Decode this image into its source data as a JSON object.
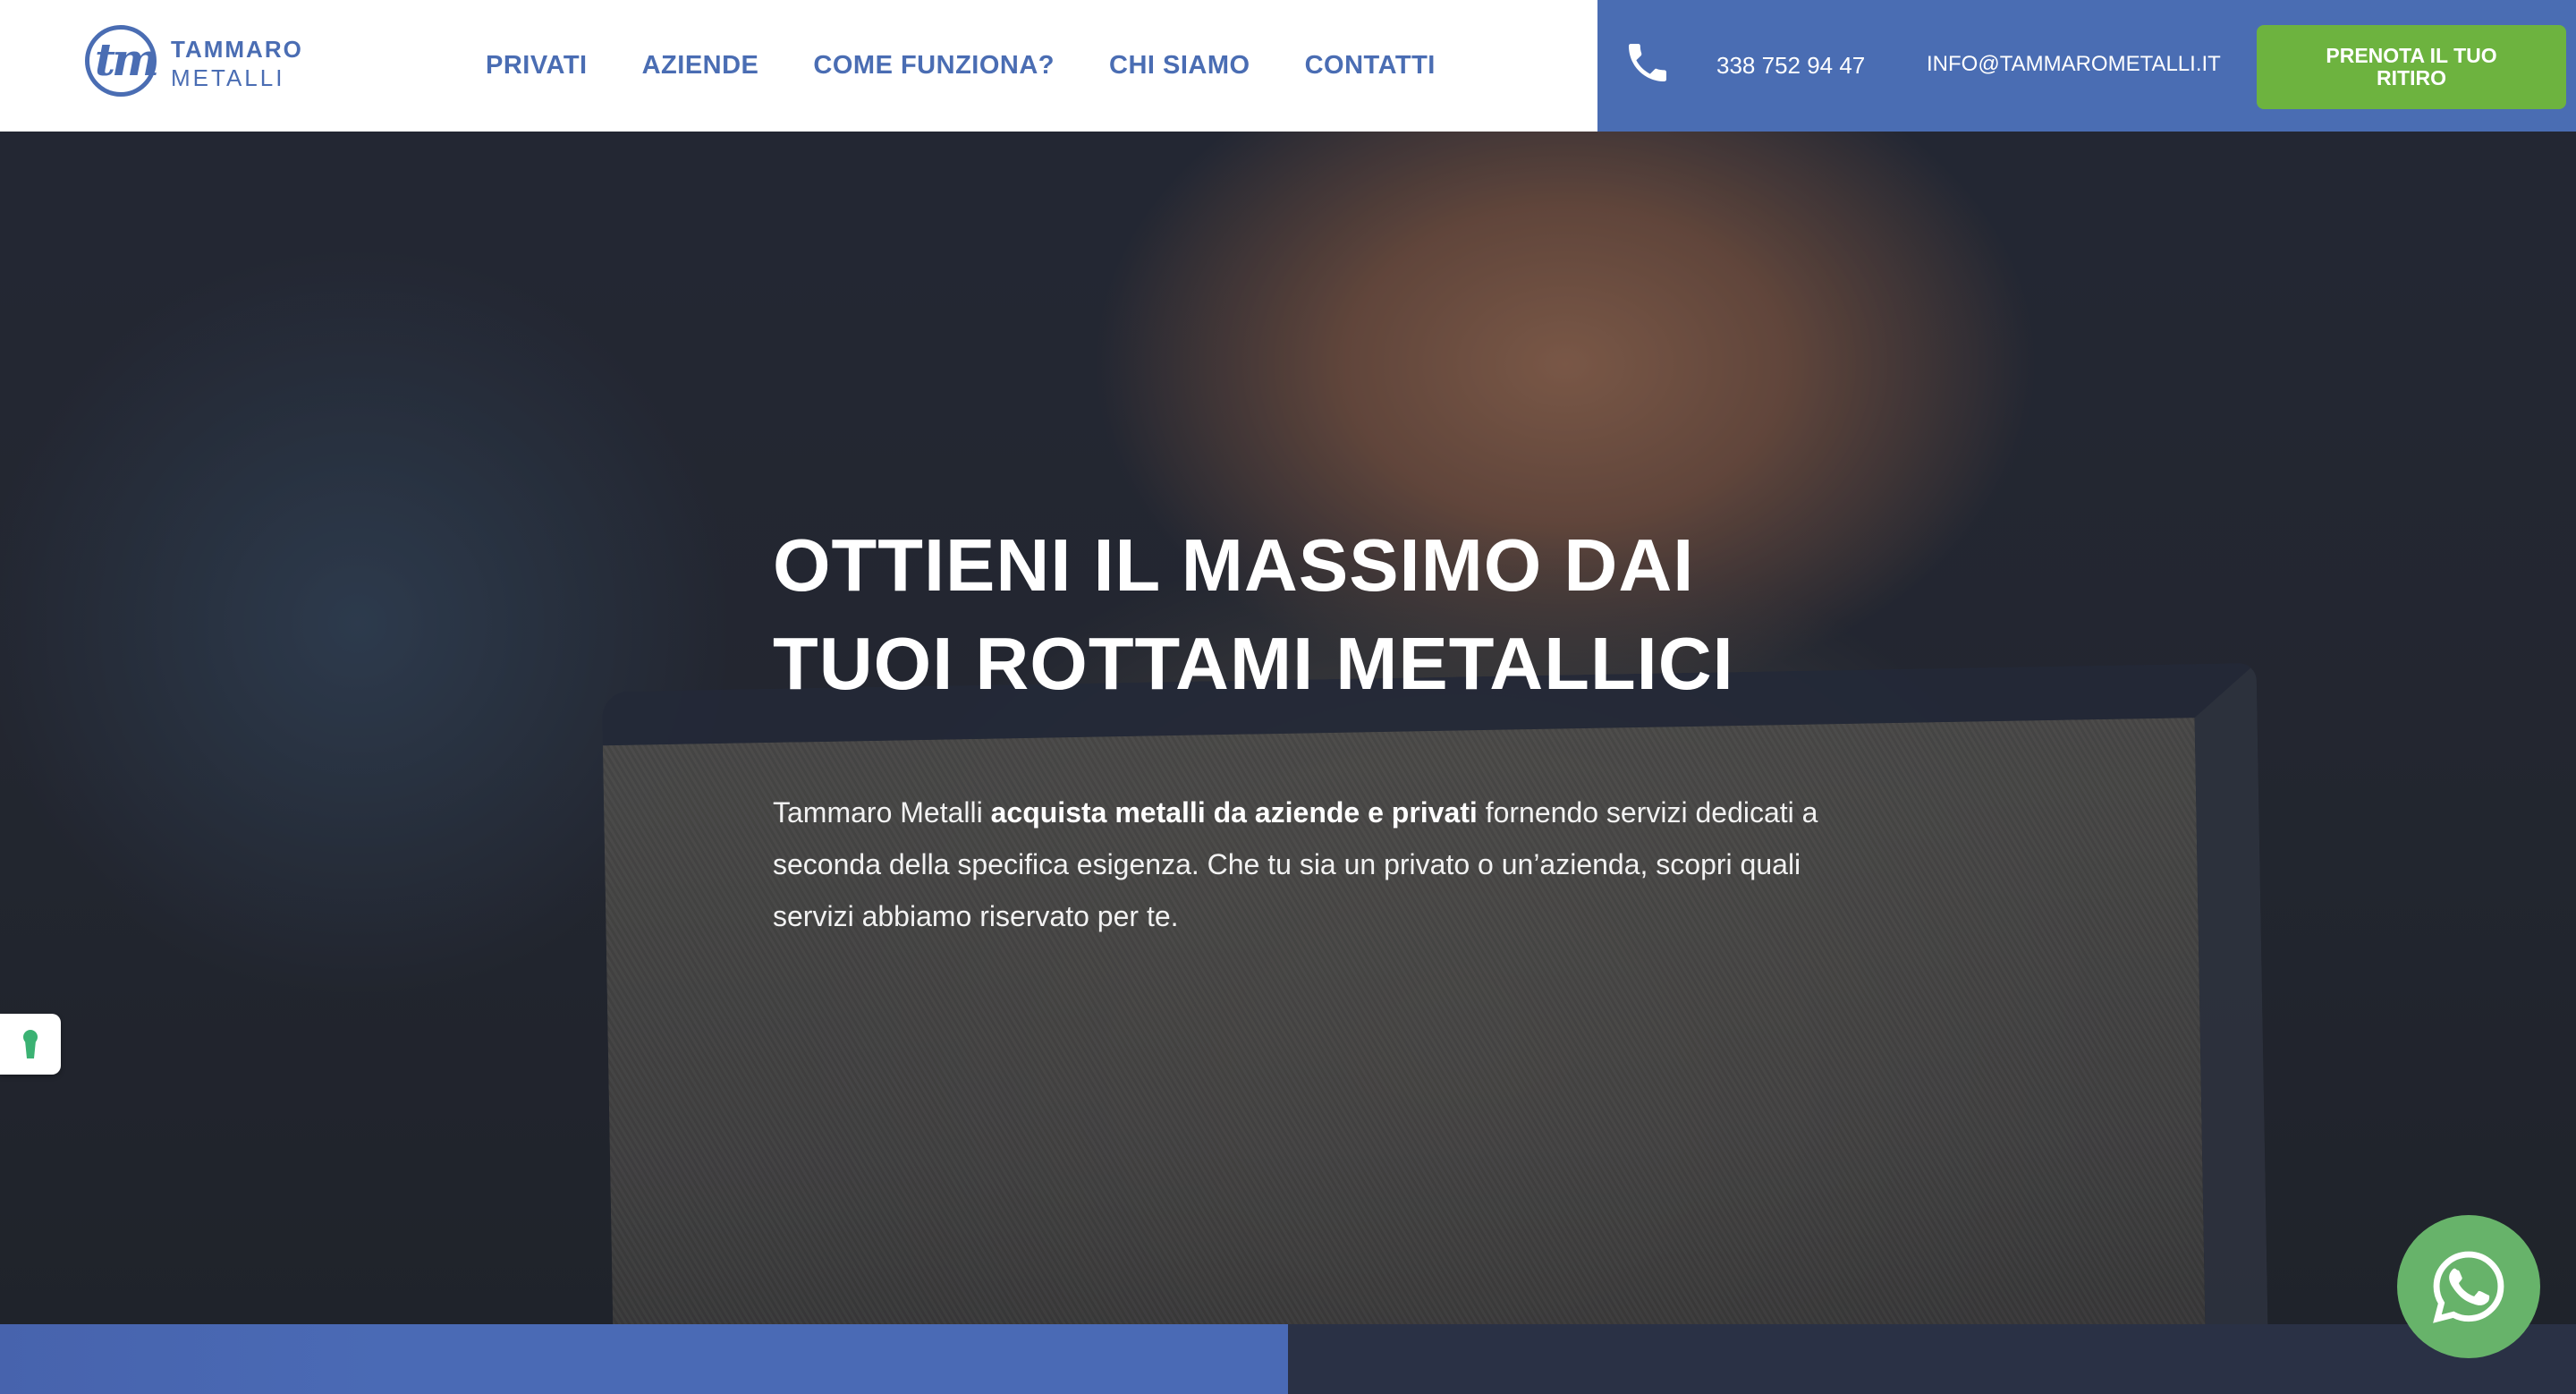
{
  "brand": {
    "mark": "tm",
    "name": "TAMMARO",
    "sub": "METALLI",
    "color": "#4a6db3"
  },
  "nav": {
    "items": [
      {
        "label": "PRIVATI"
      },
      {
        "label": "AZIENDE"
      },
      {
        "label": "COME FUNZIONA?"
      },
      {
        "label": "CHI SIAMO"
      },
      {
        "label": "CONTATTI"
      }
    ]
  },
  "contact": {
    "phone": "338 752 94 47",
    "email": "INFO@TAMMAROMETALLI.IT",
    "cta": "PRENOTA IL TUO RITIRO",
    "icons": [
      "phone-icon"
    ],
    "bar_color": "#4a6db3",
    "cta_color": "#6db33f"
  },
  "hero": {
    "title": "OTTIENI IL MASSIMO DAI TUOI ROTTAMI METALLICI",
    "text_before": "Tammaro Metalli ",
    "text_bold": "acquista metalli da aziende e privati",
    "text_after": " fornendo servizi dedicati a seconda della specifica esigenza. Che tu sia un privato o un’azienda, scopri quali servizi abbiamo riservato per te."
  },
  "widgets": {
    "cookie_icon": "keyhole-icon",
    "whatsapp_icon": "whatsapp-icon",
    "whatsapp_color": "#67b36a"
  }
}
